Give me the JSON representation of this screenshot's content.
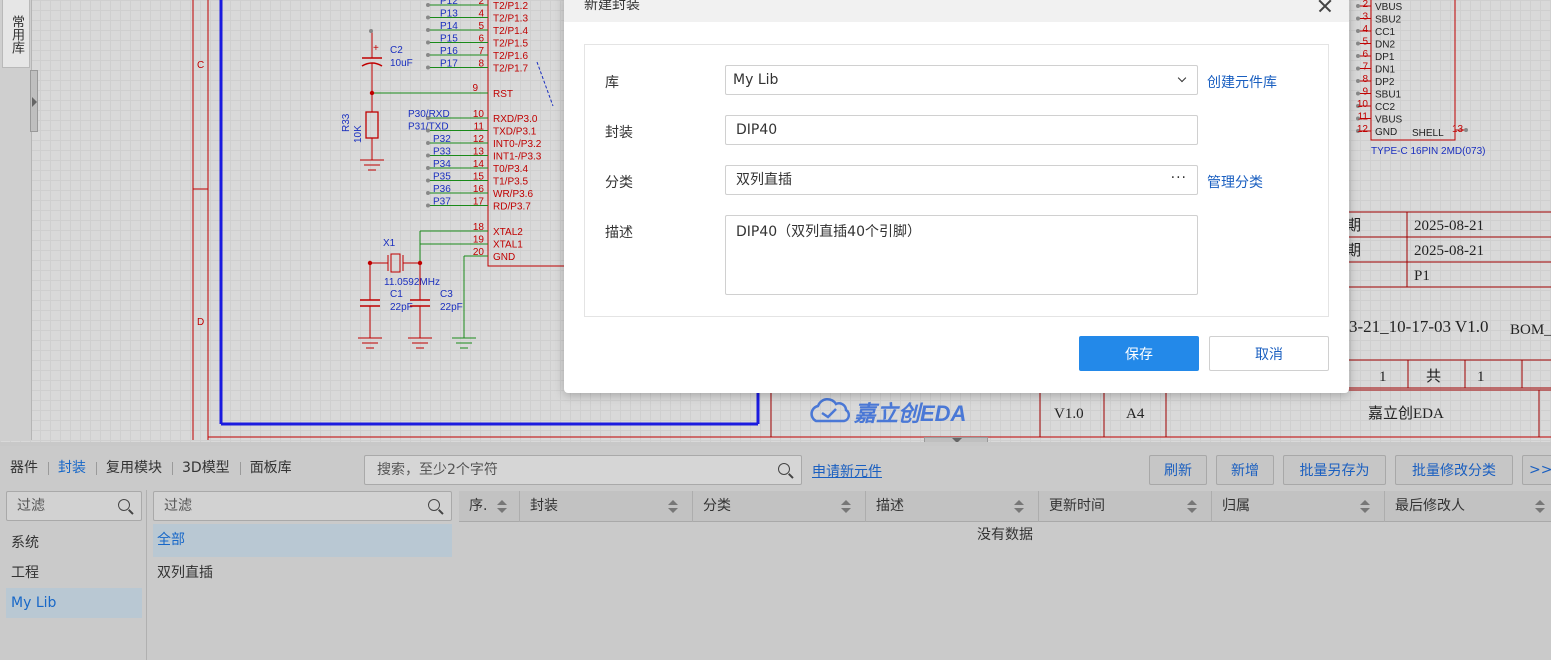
{
  "colors": {
    "accent": "#2389e9",
    "link": "#1a5fc0",
    "schematic_wire": "#1a8a1a",
    "schematic_pin": "#c00000",
    "frame_blue": "#1a1adf"
  },
  "left_panel": {
    "common_lib": "常用库"
  },
  "schematic": {
    "zone_c": "C",
    "zone_d": "D",
    "pins_top": [
      {
        "net": "P12",
        "num": "2",
        "name": "T2/P1.2"
      },
      {
        "net": "P13",
        "num": "4",
        "name": "T2/P1.3"
      },
      {
        "net": "P14",
        "num": "5",
        "name": "T2/P1.4"
      },
      {
        "net": "P15",
        "num": "6",
        "name": "T2/P1.5"
      },
      {
        "net": "P16",
        "num": "7",
        "name": "T2/P1.6"
      },
      {
        "net": "P17",
        "num": "8",
        "name": "T2/P1.7"
      }
    ],
    "rst": {
      "num": "9",
      "name": "RST"
    },
    "pins_p3": [
      {
        "net": "P30/RXD",
        "num": "10",
        "name": "RXD/P3.0"
      },
      {
        "net": "P31/TXD",
        "num": "11",
        "name": "TXD/P3.1"
      },
      {
        "net": "P32",
        "num": "12",
        "name": "INT0-/P3.2"
      },
      {
        "net": "P33",
        "num": "13",
        "name": "INT1-/P3.3"
      },
      {
        "net": "P34",
        "num": "14",
        "name": "T0/P3.4"
      },
      {
        "net": "P35",
        "num": "15",
        "name": "T1/P3.5"
      },
      {
        "net": "P36",
        "num": "16",
        "name": "WR/P3.6"
      },
      {
        "net": "P37",
        "num": "17",
        "name": "RD/P3.7"
      }
    ],
    "pins_bottom": [
      {
        "num": "18",
        "name": "XTAL2"
      },
      {
        "num": "19",
        "name": "XTAL1"
      },
      {
        "num": "20",
        "name": "GND"
      }
    ],
    "c2": {
      "ref": "C2",
      "value": "10uF"
    },
    "r33": {
      "ref": "R33",
      "value": "10K"
    },
    "x1": {
      "ref": "X1",
      "value": "11.0592MHz"
    },
    "c1": {
      "ref": "C1",
      "value": "22pF"
    },
    "c3": {
      "ref": "C3",
      "value": "22pF"
    },
    "typec": {
      "pins": [
        {
          "num": "2",
          "name": "VBUS"
        },
        {
          "num": "3",
          "name": "SBU2"
        },
        {
          "num": "4",
          "name": "CC1"
        },
        {
          "num": "5",
          "name": "DN2"
        },
        {
          "num": "6",
          "name": "DP1"
        },
        {
          "num": "7",
          "name": "DN1"
        },
        {
          "num": "8",
          "name": "DP2"
        },
        {
          "num": "9",
          "name": "SBU1"
        },
        {
          "num": "10",
          "name": "CC2"
        },
        {
          "num": "11",
          "name": "VBUS"
        },
        {
          "num": "12",
          "name": "GND"
        }
      ],
      "shell": "SHELL",
      "shell_num": "13",
      "part": "TYPE-C 16PIN 2MD(073)"
    },
    "title_block": {
      "date1_label": "期",
      "date1": "2025-08-21",
      "date2_label": "期",
      "date2": "2025-08-21",
      "page": "P1",
      "filename": "3-21_10-17-03 V1.0",
      "bom": "BOM_",
      "sheet_num": "1",
      "total_label": "共",
      "total": "1",
      "brand": "嘉立创EDA",
      "version": "V1.0",
      "size": "A4",
      "company": "嘉立创EDA"
    }
  },
  "bottom_panel": {
    "tabs": [
      {
        "label": "器件",
        "active": false
      },
      {
        "label": "封装",
        "active": true
      },
      {
        "label": "复用模块",
        "active": false
      },
      {
        "label": "3D模型",
        "active": false
      },
      {
        "label": "面板库",
        "active": false
      }
    ],
    "search_placeholder": "搜索，至少2个字符",
    "apply_link": "申请新元件",
    "buttons": {
      "refresh": "刷新",
      "add": "新增",
      "batch_save_as": "批量另存为",
      "batch_edit_category": "批量修改分类",
      "more": ">>"
    },
    "lib_filter_placeholder": "过滤",
    "category_filter_placeholder": "过滤",
    "libraries": [
      {
        "label": "系统",
        "selected": false
      },
      {
        "label": "工程",
        "selected": false
      },
      {
        "label": "My Lib",
        "selected": true
      }
    ],
    "categories": [
      {
        "label": "全部",
        "selected": true
      },
      {
        "label": "双列直插",
        "selected": false
      }
    ],
    "columns": [
      "序.",
      "封装",
      "分类",
      "描述",
      "更新时间",
      "归属",
      "最后修改人"
    ],
    "empty_text": "没有数据"
  },
  "modal": {
    "title": "新建封装",
    "fields": {
      "library_label": "库",
      "library_value": "My Lib",
      "create_library_link": "创建元件库",
      "footprint_label": "封装",
      "footprint_value": "DIP40",
      "category_label": "分类",
      "category_value": "双列直插",
      "manage_category_link": "管理分类",
      "description_label": "描述",
      "description_value": "DIP40（双列直插40个引脚）"
    },
    "save_label": "保存",
    "cancel_label": "取消"
  }
}
